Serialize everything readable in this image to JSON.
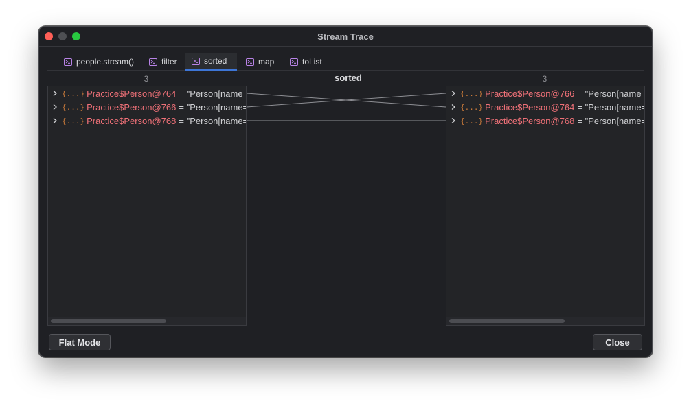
{
  "window": {
    "title": "Stream Trace"
  },
  "tabs": [
    {
      "label": "people.stream()",
      "icon": "terminal-icon"
    },
    {
      "label": "filter",
      "icon": "terminal-icon"
    },
    {
      "label": "sorted",
      "icon": "terminal-icon",
      "active": true
    },
    {
      "label": "map",
      "icon": "terminal-icon"
    },
    {
      "label": "toList",
      "icon": "terminal-icon"
    }
  ],
  "stage": {
    "title": "sorted"
  },
  "left_panel": {
    "count": "3",
    "rows": [
      {
        "icon": "{...}",
        "name": "Practice$Person@764",
        "value": "= \"Person[name="
      },
      {
        "icon": "{...}",
        "name": "Practice$Person@766",
        "value": "= \"Person[name="
      },
      {
        "icon": "{...}",
        "name": "Practice$Person@768",
        "value": "= \"Person[name="
      }
    ]
  },
  "right_panel": {
    "count": "3",
    "rows": [
      {
        "icon": "{...}",
        "name": "Practice$Person@766",
        "value": "= \"Person[name="
      },
      {
        "icon": "{...}",
        "name": "Practice$Person@764",
        "value": "= \"Person[name="
      },
      {
        "icon": "{...}",
        "name": "Practice$Person@768",
        "value": "= \"Person[name="
      }
    ]
  },
  "mapping": [
    [
      0,
      1
    ],
    [
      1,
      0
    ],
    [
      2,
      2
    ]
  ],
  "buttons": {
    "flat_mode": "Flat Mode",
    "close": "Close"
  },
  "colors": {
    "window_bg": "#1f2024",
    "panel_bg": "#232427",
    "active_tab_underline": "#3d75d6",
    "object_name": "#f07178",
    "object_icon": "#c7793a",
    "tab_icon": "#b883e6",
    "connector_line": "#8e8f94"
  }
}
